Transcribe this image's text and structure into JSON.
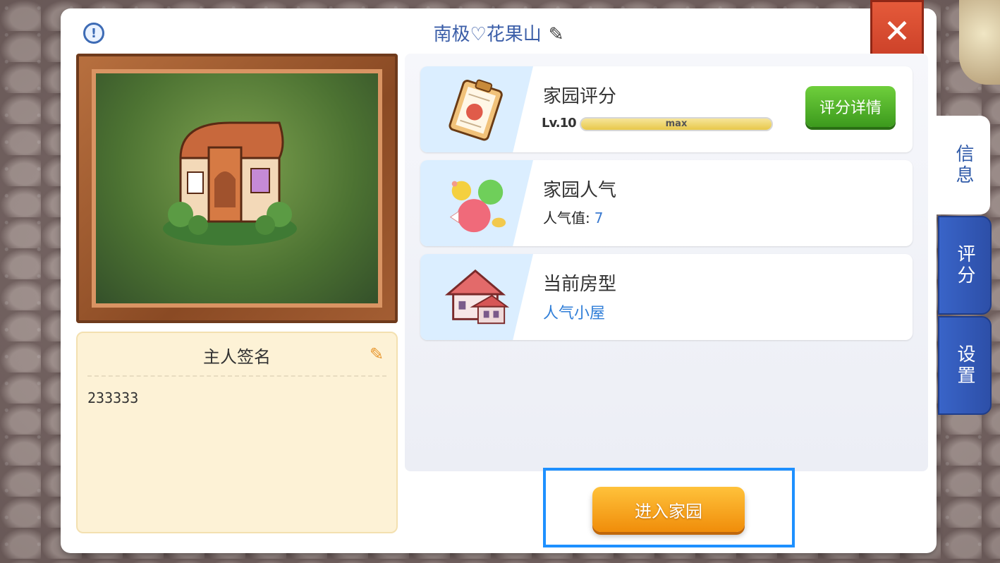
{
  "header": {
    "title": "南极♡花果山"
  },
  "signature": {
    "title": "主人签名",
    "text": "233333"
  },
  "cards": {
    "rating": {
      "title": "家园评分",
      "level_label": "Lv.10",
      "progress_label": "max",
      "progress_fraction": 1.0,
      "detail_button": "评分详情"
    },
    "popularity": {
      "title": "家园人气",
      "stat_label": "人气值:",
      "stat_value": "7"
    },
    "house": {
      "title": "当前房型",
      "value": "人气小屋"
    }
  },
  "actions": {
    "enter_label": "进入家园"
  },
  "tabs": [
    {
      "label": "信息",
      "active": true
    },
    {
      "label": "评分",
      "active": false
    },
    {
      "label": "设置",
      "active": false
    }
  ],
  "icons": {
    "info": "info-icon",
    "close": "close-icon",
    "edit_title": "pencil-icon",
    "edit_signature": "edit-icon"
  },
  "colors": {
    "accent_blue": "#3b5ea8",
    "close_red": "#d5452b",
    "detail_green": "#4caf2a",
    "enter_orange": "#f5a11c",
    "highlight": "#1e90ff"
  }
}
